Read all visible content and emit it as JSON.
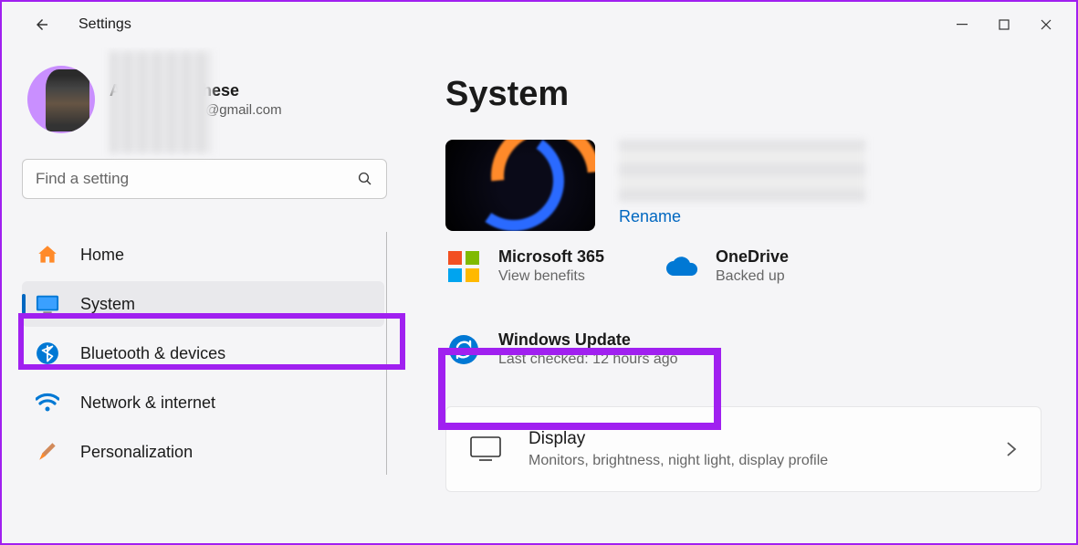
{
  "window": {
    "title": "Settings"
  },
  "user": {
    "name": "Anoop Varghese",
    "email_suffix": "@gmail.com"
  },
  "search": {
    "placeholder": "Find a setting"
  },
  "nav": {
    "home": "Home",
    "system": "System",
    "bluetooth": "Bluetooth & devices",
    "network": "Network & internet",
    "personalization": "Personalization"
  },
  "page": {
    "title": "System"
  },
  "device": {
    "rename": "Rename"
  },
  "cards": {
    "m365": {
      "title": "Microsoft 365",
      "sub": "View benefits"
    },
    "onedrive": {
      "title": "OneDrive",
      "sub": "Backed up"
    },
    "update": {
      "title": "Windows Update",
      "sub": "Last checked: 12 hours ago"
    }
  },
  "tiles": {
    "display": {
      "title": "Display",
      "sub": "Monitors, brightness, night light, display profile"
    }
  }
}
